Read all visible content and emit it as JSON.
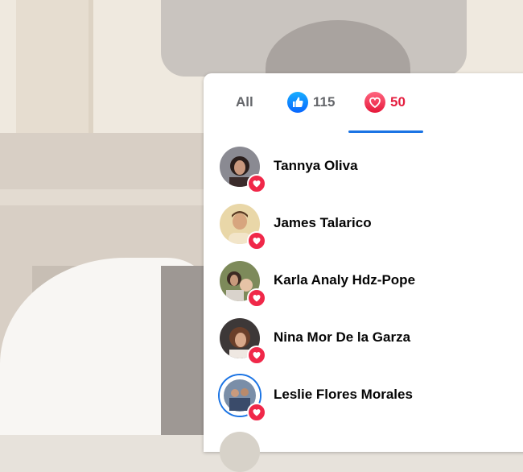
{
  "tabs": {
    "all_label": "All",
    "like_count": "115",
    "love_count": "50"
  },
  "colors": {
    "active_tab_underline": "#1b74e4",
    "love_red": "#e41e3f",
    "like_blue": "#0866ff"
  },
  "reactors": [
    {
      "name": "Tannya Oliva",
      "reaction": "love-icon"
    },
    {
      "name": "James Talarico",
      "reaction": "love-icon"
    },
    {
      "name": "Karla Analy Hdz-Pope",
      "reaction": "love-icon"
    },
    {
      "name": "Nina Mor De la Garza",
      "reaction": "love-icon"
    },
    {
      "name": "Leslie Flores Morales",
      "reaction": "love-icon"
    }
  ]
}
